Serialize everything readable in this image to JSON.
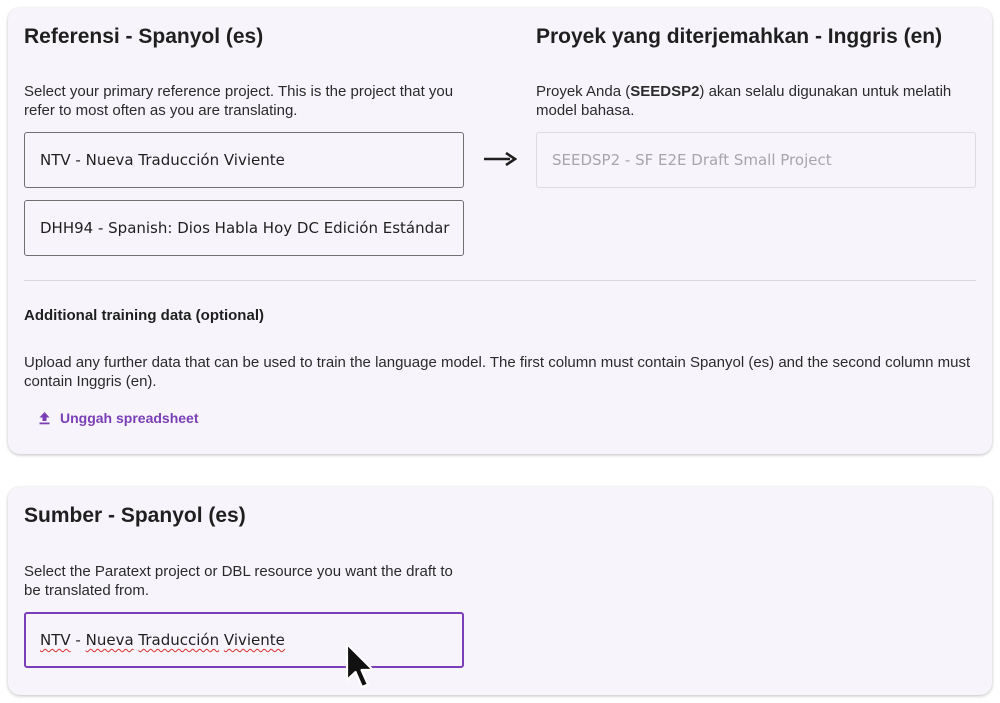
{
  "reference": {
    "title": "Referensi - Spanyol (es)",
    "description": "Select your primary reference project. This is the project that you refer to most often as you are translating.",
    "primary_project": "NTV - Nueva Traducción Viviente",
    "secondary_project": "DHH94 - Spanish: Dios Habla Hoy DC Edición Estándar"
  },
  "translated": {
    "title": "Proyek yang diterjemahkan - Inggris (en)",
    "desc_prefix": "Proyek Anda (",
    "project_code": "SEEDSP2",
    "desc_suffix": ") akan selalu digunakan untuk melatih model bahasa.",
    "project": "SEEDSP2 - SF E2E Draft Small Project"
  },
  "additional": {
    "title": "Additional training data (optional)",
    "description": "Upload any further data that can be used to train the language model. The first column must contain Spanyol (es) and the second column must contain Inggris (en).",
    "upload_label": "Unggah spreadsheet"
  },
  "source": {
    "title": "Sumber - Spanyol (es)",
    "description": "Select the Paratext project or DBL resource you want the draft to be translated from.",
    "project_words": [
      "NTV",
      " - ",
      "Nueva",
      " ",
      "Traducción",
      " ",
      "Viviente"
    ]
  },
  "icons": {
    "arrow": "arrow-right-icon",
    "upload": "upload-icon",
    "cursor": "mouse-pointer-icon"
  },
  "colors": {
    "accent": "#7a3fb7",
    "card_bg": "#f7f5fb",
    "spellcheck": "#d9302c"
  }
}
